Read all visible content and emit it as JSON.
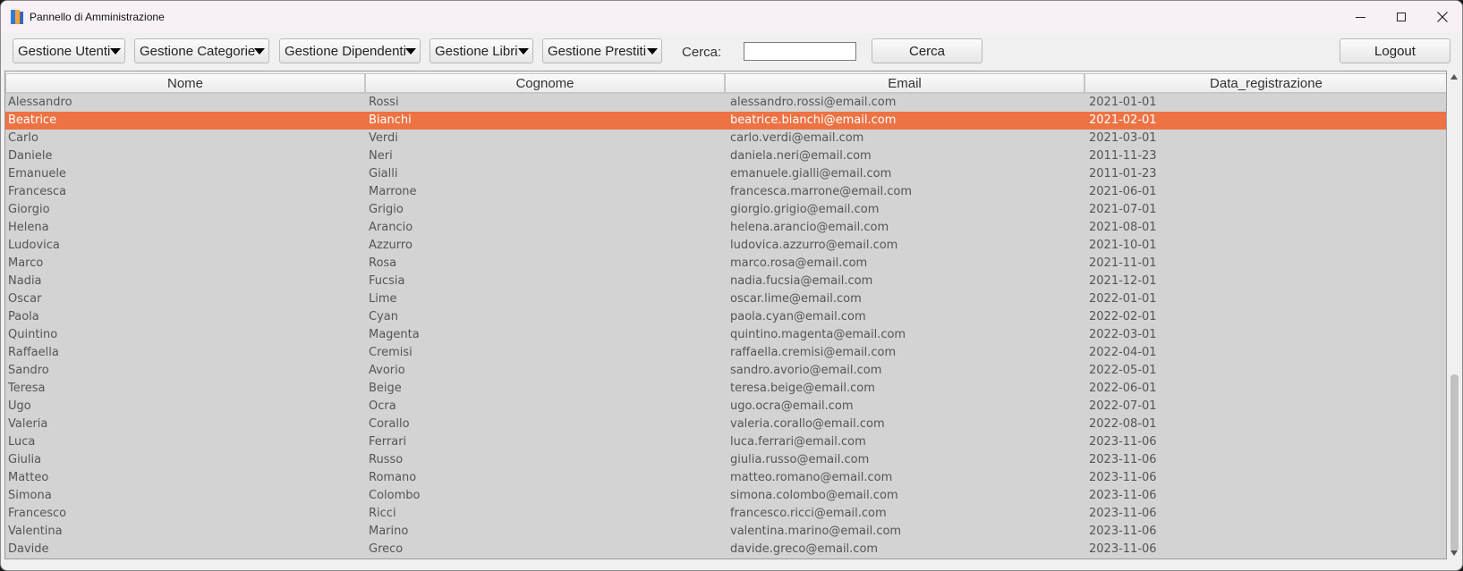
{
  "window": {
    "title": "Pannello di Amministrazione"
  },
  "toolbar": {
    "menus": [
      {
        "label": "Gestione Utenti"
      },
      {
        "label": "Gestione Categorie"
      },
      {
        "label": "Gestione Dipendenti"
      },
      {
        "label": "Gestione Libri"
      },
      {
        "label": "Gestione Prestiti"
      }
    ],
    "search_label": "Cerca:",
    "search_value": "",
    "search_button": "Cerca",
    "logout_button": "Logout"
  },
  "table": {
    "columns": [
      "Nome",
      "Cognome",
      "Email",
      "Data_registrazione"
    ],
    "selected_row": 1,
    "rows": [
      [
        "Alessandro",
        "Rossi",
        "alessandro.rossi@email.com",
        "2021-01-01"
      ],
      [
        "Beatrice",
        "Bianchi",
        "beatrice.bianchi@email.com",
        "2021-02-01"
      ],
      [
        "Carlo",
        "Verdi",
        "carlo.verdi@email.com",
        "2021-03-01"
      ],
      [
        "Daniele",
        "Neri",
        "daniela.neri@email.com",
        "2011-11-23"
      ],
      [
        "Emanuele",
        "Gialli",
        "emanuele.gialli@email.com",
        "2011-01-23"
      ],
      [
        "Francesca",
        "Marrone",
        "francesca.marrone@email.com",
        "2021-06-01"
      ],
      [
        "Giorgio",
        "Grigio",
        "giorgio.grigio@email.com",
        "2021-07-01"
      ],
      [
        "Helena",
        "Arancio",
        "helena.arancio@email.com",
        "2021-08-01"
      ],
      [
        "Ludovica",
        "Azzurro",
        "ludovica.azzurro@email.com",
        "2021-10-01"
      ],
      [
        "Marco",
        "Rosa",
        "marco.rosa@email.com",
        "2021-11-01"
      ],
      [
        "Nadia",
        "Fucsia",
        "nadia.fucsia@email.com",
        "2021-12-01"
      ],
      [
        "Oscar",
        "Lime",
        "oscar.lime@email.com",
        "2022-01-01"
      ],
      [
        "Paola",
        "Cyan",
        "paola.cyan@email.com",
        "2022-02-01"
      ],
      [
        "Quintino",
        "Magenta",
        "quintino.magenta@email.com",
        "2022-03-01"
      ],
      [
        "Raffaella",
        "Cremisi",
        "raffaella.cremisi@email.com",
        "2022-04-01"
      ],
      [
        "Sandro",
        "Avorio",
        "sandro.avorio@email.com",
        "2022-05-01"
      ],
      [
        "Teresa",
        "Beige",
        "teresa.beige@email.com",
        "2022-06-01"
      ],
      [
        "Ugo",
        "Ocra",
        "ugo.ocra@email.com",
        "2022-07-01"
      ],
      [
        "Valeria",
        "Corallo",
        "valeria.corallo@email.com",
        "2022-08-01"
      ],
      [
        "Luca",
        "Ferrari",
        "luca.ferrari@email.com",
        "2023-11-06"
      ],
      [
        "Giulia",
        "Russo",
        "giulia.russo@email.com",
        "2023-11-06"
      ],
      [
        "Matteo",
        "Romano",
        "matteo.romano@email.com",
        "2023-11-06"
      ],
      [
        "Simona",
        "Colombo",
        "simona.colombo@email.com",
        "2023-11-06"
      ],
      [
        "Francesco",
        "Ricci",
        "francesco.ricci@email.com",
        "2023-11-06"
      ],
      [
        "Valentina",
        "Marino",
        "valentina.marino@email.com",
        "2023-11-06"
      ],
      [
        "Davide",
        "Greco",
        "davide.greco@email.com",
        "2023-11-06"
      ]
    ]
  },
  "colors": {
    "selection": "#ed7344",
    "row_background": "#d3d3d3",
    "title_bar": "#f7f1f7"
  },
  "icons": {
    "app": "books-icon",
    "minimize": "minimize-icon",
    "maximize": "maximize-icon",
    "close": "close-icon",
    "dropdown": "caret-down-icon"
  }
}
